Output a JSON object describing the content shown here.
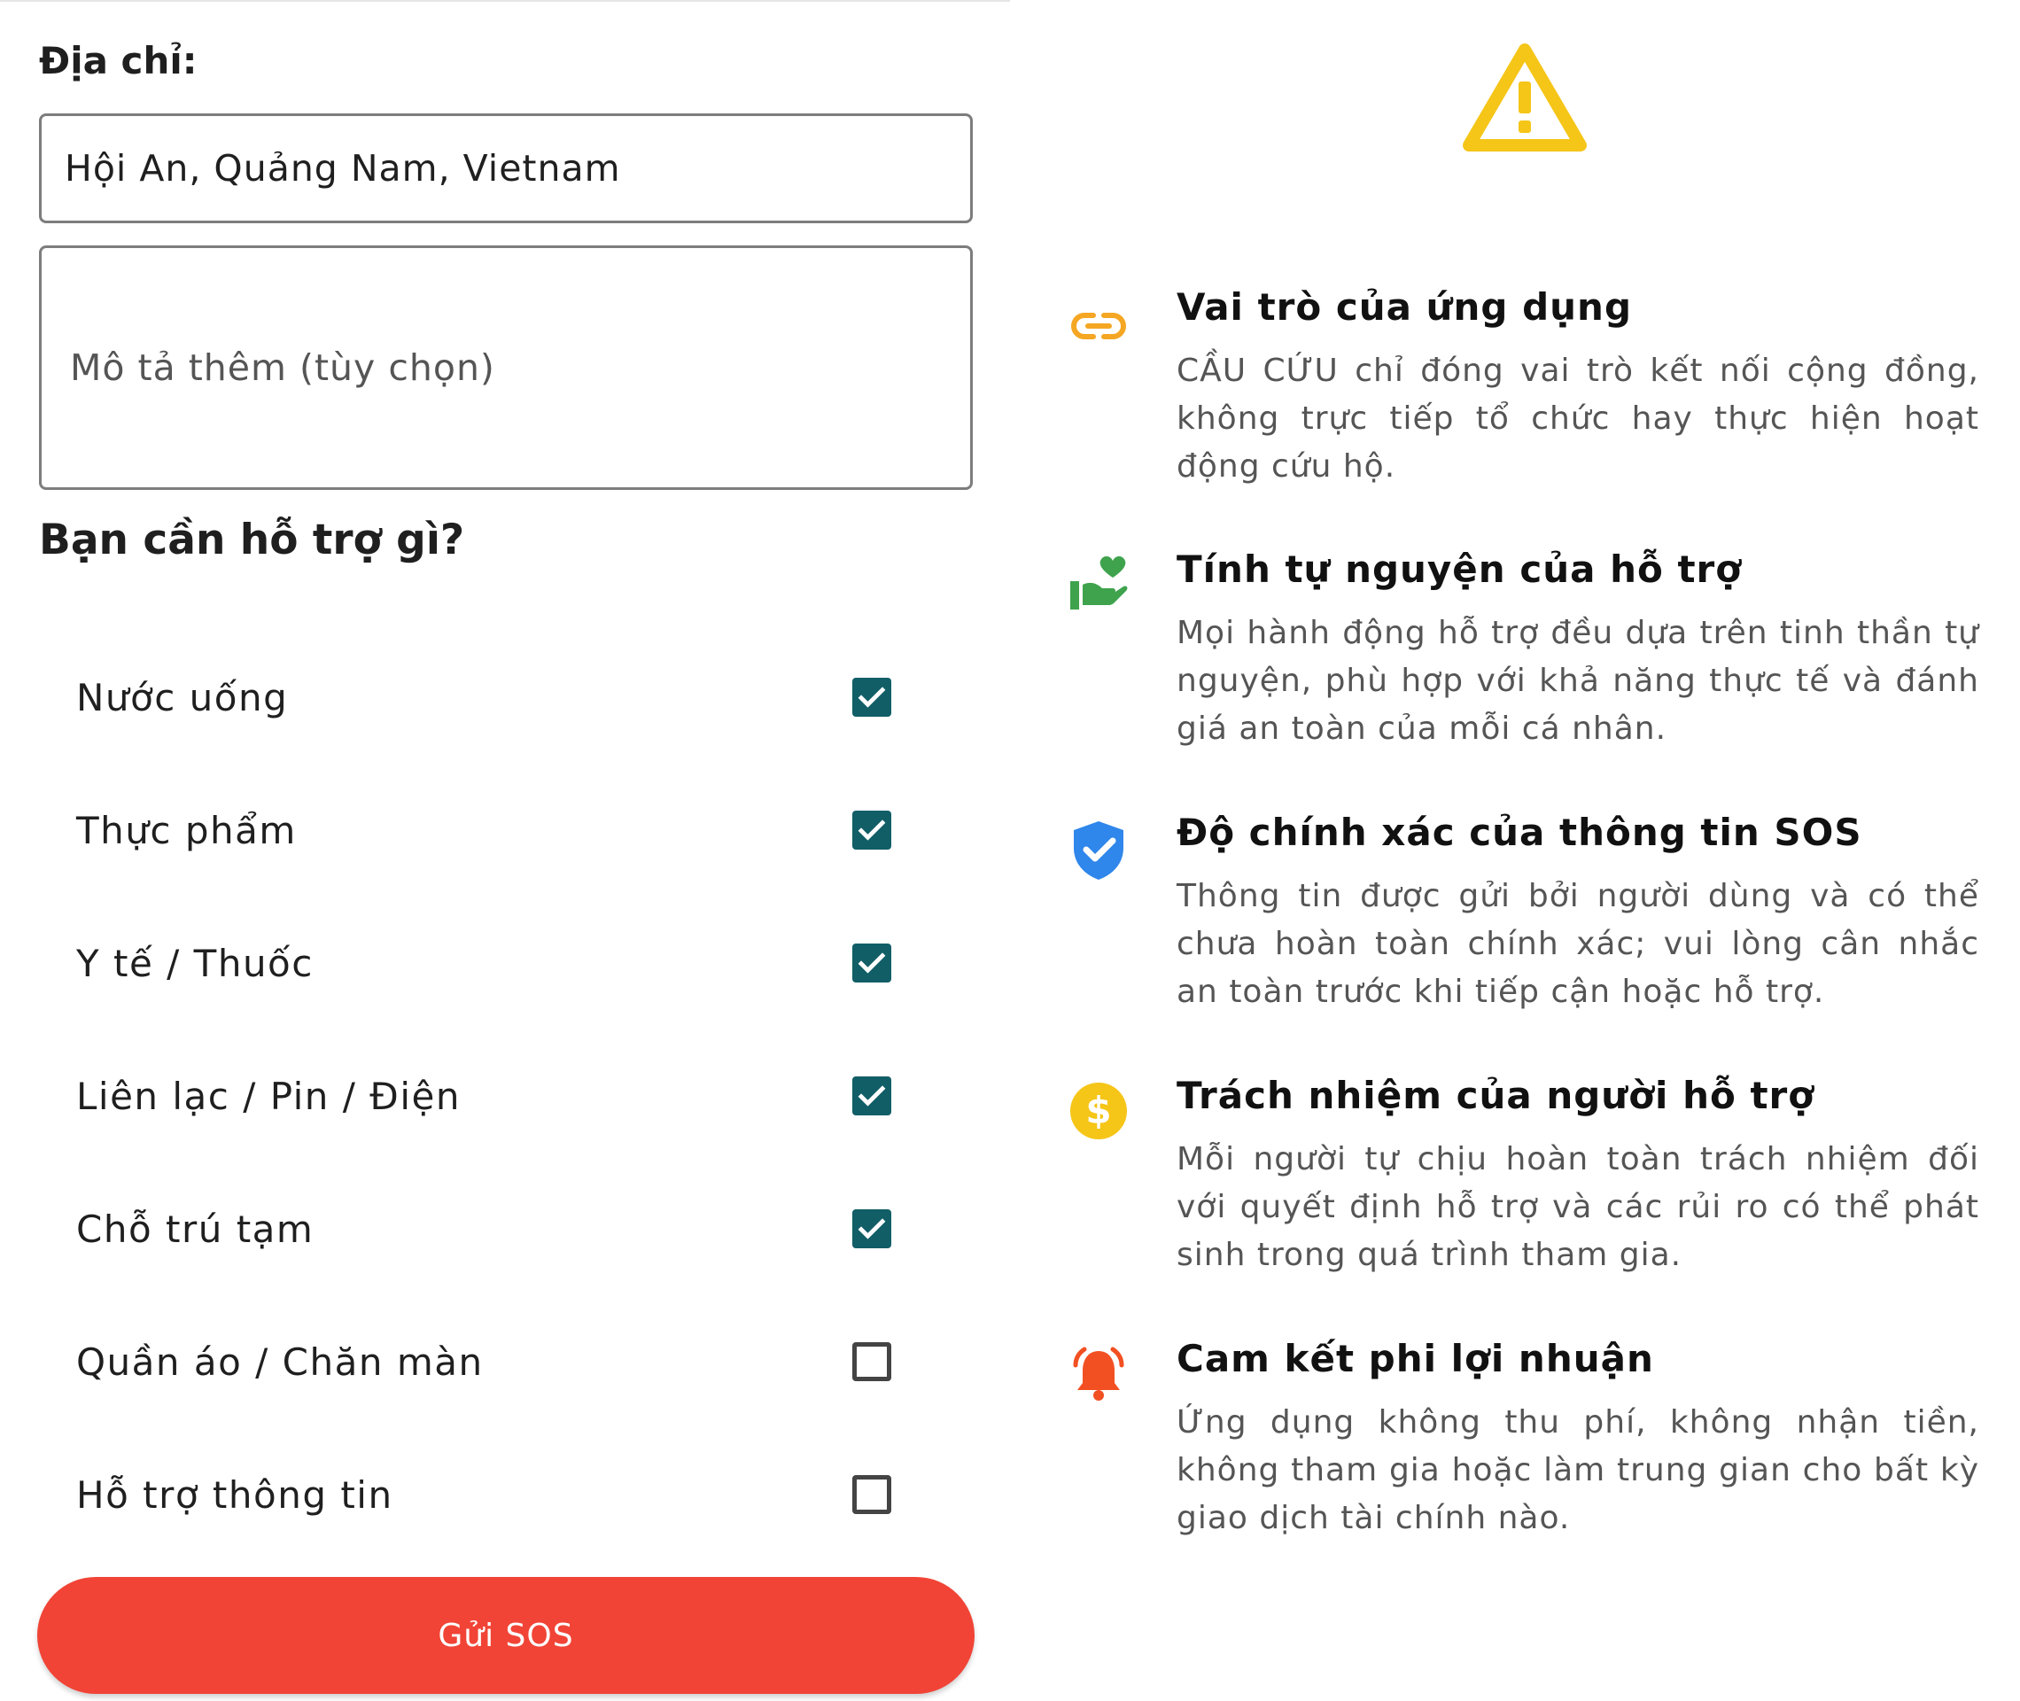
{
  "form": {
    "address_label": "Địa chỉ:",
    "address_value": "Hội An, Quảng Nam, Vietnam",
    "description_placeholder": "Mô tả thêm (tùy chọn)",
    "help_title": "Bạn cần hỗ trợ gì?",
    "options": [
      {
        "label": "Nước uống",
        "checked": true
      },
      {
        "label": "Thực phẩm",
        "checked": true
      },
      {
        "label": "Y tế / Thuốc",
        "checked": true
      },
      {
        "label": "Liên lạc / Pin / Điện",
        "checked": true
      },
      {
        "label": "Chỗ trú tạm",
        "checked": true
      },
      {
        "label": "Quần áo / Chăn màn",
        "checked": false
      },
      {
        "label": "Hỗ trợ thông tin",
        "checked": false
      }
    ],
    "submit_label": "Gửi SOS"
  },
  "disclaimer": {
    "header_icon": "warning-icon",
    "items": [
      {
        "icon": "link-icon",
        "title": "Vai trò của ứng dụng",
        "body": "CẦU CỨU chỉ đóng vai trò kết nối cộng đồng, không trực tiếp tổ chức hay thực hiện hoạt động cứu hộ."
      },
      {
        "icon": "volunteer-icon",
        "title": "Tính tự nguyện của hỗ trợ",
        "body": "Mọi hành động hỗ trợ đều dựa trên tinh thần tự nguyện, phù hợp với khả năng thực tế và đánh giá an toàn của mỗi cá nhân."
      },
      {
        "icon": "verified-shield-icon",
        "title": "Độ chính xác của thông tin SOS",
        "body": "Thông tin được gửi bởi người dùng và có thể chưa hoàn toàn chính xác; vui lòng cân nhắc an toàn trước khi tiếp cận hoặc hỗ trợ."
      },
      {
        "icon": "dollar-coin-icon",
        "title": "Trách nhiệm của người hỗ trợ",
        "body": "Mỗi người tự chịu hoàn toàn trách nhiệm đối với quyết định hỗ trợ và các rủi ro có thể phát sinh trong quá trình tham gia."
      },
      {
        "icon": "alarm-bell-icon",
        "title": "Cam kết phi lợi nhuận",
        "body": "Ứng dụng không thu phí, không nhận tiền, không tham gia hoặc làm trung gian cho bất kỳ giao dịch tài chính nào."
      }
    ]
  },
  "colors": {
    "checkbox_checked": "#115e67",
    "sos_button": "#f14436",
    "warning": "#f5c518",
    "link": "#f5a623",
    "volunteer": "#3fa34d",
    "shield": "#2f86eb",
    "coin": "#f5c518",
    "bell": "#f25022"
  }
}
